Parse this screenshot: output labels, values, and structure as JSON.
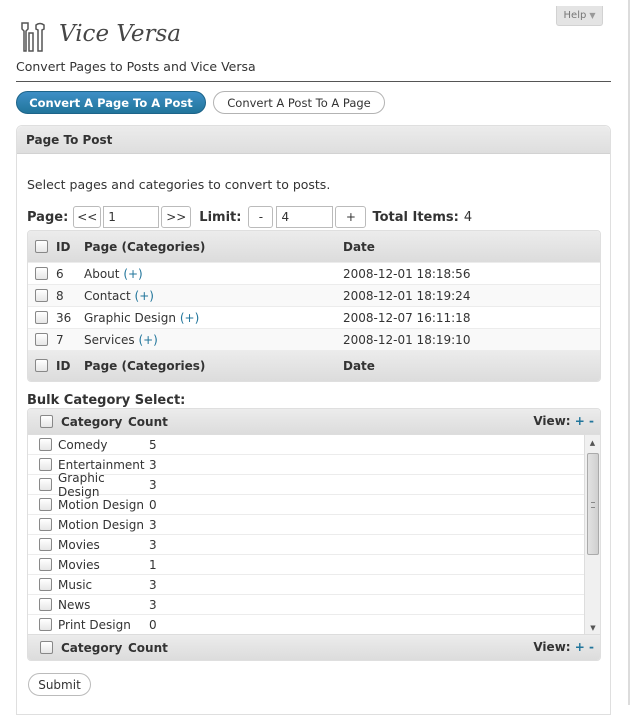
{
  "help": {
    "label": "Help",
    "arrow": "▼"
  },
  "header": {
    "title": "Vice Versa",
    "subtitle": "Convert Pages to Posts and Vice Versa"
  },
  "modes": {
    "active": "Convert A Page To A Post",
    "inactive": "Convert A Post To A Page"
  },
  "panel": {
    "title": "Page To Post",
    "instructions": "Select pages and categories to convert to posts."
  },
  "pager": {
    "page_label": "Page:",
    "prev": "<<",
    "page_value": "1",
    "next": ">>",
    "limit_label": "Limit:",
    "minus": "-",
    "limit_value": "4",
    "plus": "+",
    "total_label": "Total Items:",
    "total_value": "4"
  },
  "pages_table": {
    "columns": {
      "id": "ID",
      "page": "Page (Categories)",
      "date": "Date"
    },
    "rows": [
      {
        "id": "6",
        "name": "About",
        "plus": "(+)",
        "date": "2008-12-01 18:18:56"
      },
      {
        "id": "8",
        "name": "Contact",
        "plus": "(+)",
        "date": "2008-12-01 18:19:24"
      },
      {
        "id": "36",
        "name": "Graphic Design",
        "plus": "(+)",
        "date": "2008-12-07 16:11:18"
      },
      {
        "id": "7",
        "name": "Services",
        "plus": "(+)",
        "date": "2008-12-01 18:19:10"
      }
    ]
  },
  "bulk": {
    "title": "Bulk Category Select:",
    "columns": {
      "category": "Category",
      "count": "Count"
    },
    "view_label": "View:",
    "view_plus": "+",
    "view_minus": "-",
    "categories": [
      {
        "name": "Comedy",
        "count": "5"
      },
      {
        "name": "Entertainment",
        "count": "3"
      },
      {
        "name": "Graphic Design",
        "count": "3"
      },
      {
        "name": "Motion Design",
        "count": "0"
      },
      {
        "name": "Motion Design",
        "count": "3"
      },
      {
        "name": "Movies",
        "count": "3"
      },
      {
        "name": "Movies",
        "count": "1"
      },
      {
        "name": "Music",
        "count": "3"
      },
      {
        "name": "News",
        "count": "3"
      },
      {
        "name": "Print Design",
        "count": "0"
      }
    ]
  },
  "submit_label": "Submit",
  "colors": {
    "accent": "#21759b",
    "header_bg": "#dedede",
    "text": "#333333"
  }
}
